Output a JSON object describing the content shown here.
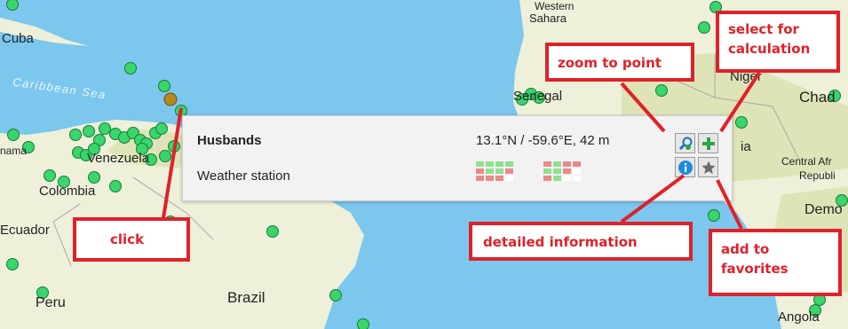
{
  "map": {
    "colors": {
      "sea": "#7cc7ee",
      "land": "#eef0d9",
      "land_dark": "#dfe4b8",
      "station": "#39d66b",
      "station_selected": "#b38a1c"
    },
    "place_labels": {
      "sahara": "Sahara",
      "western": "Western",
      "cuba": "Cuba",
      "caribbean": "Caribbean Sea",
      "senegal": "Senegal",
      "niger": "Niger",
      "chad": "Chad",
      "nama": "nama",
      "venezuela": "Venezuela",
      "colombia": "Colombia",
      "ecuador": "Ecuador",
      "peru": "Peru",
      "brazil": "Brazil",
      "ia": "ia",
      "central_africa": "Central Afr",
      "republic": "Republi",
      "demo": "Demo",
      "angola": "Angola"
    }
  },
  "popup": {
    "station_name": "Husbands",
    "station_type": "Weather station",
    "coords": "13.1°N / -59.6°E, 42 m",
    "availability_grid_1": [
      "#8ee08e",
      "#8ee08e",
      "#8ee08e",
      "#8ee08e",
      "#e88a8a",
      "#8ee08e",
      "#8ee08e",
      "#e88a8a",
      "#e88a8a",
      "#e88a8a",
      "#e88a8a",
      "#ffffff"
    ],
    "availability_grid_2": [
      "#e88a8a",
      "#8ee08e",
      "#e88a8a",
      "#e88a8a",
      "#8ee08e",
      "#8ee08e",
      "#e88a8a",
      "#ffffff",
      "#e88a8a",
      "#8ee08e",
      "#ffffff",
      "#ffffff"
    ],
    "buttons": {
      "zoom": "zoom-to-point-icon",
      "add": "plus-icon",
      "info": "info-icon",
      "favorite": "star-icon"
    }
  },
  "callouts": {
    "zoom": "zoom to point",
    "select_line1": "select for",
    "select_line2": "calculation",
    "click": "click",
    "detailed": "detailed information",
    "fav_line1": "add to",
    "fav_line2": "favorites"
  },
  "annotation_color": "#e0212a"
}
